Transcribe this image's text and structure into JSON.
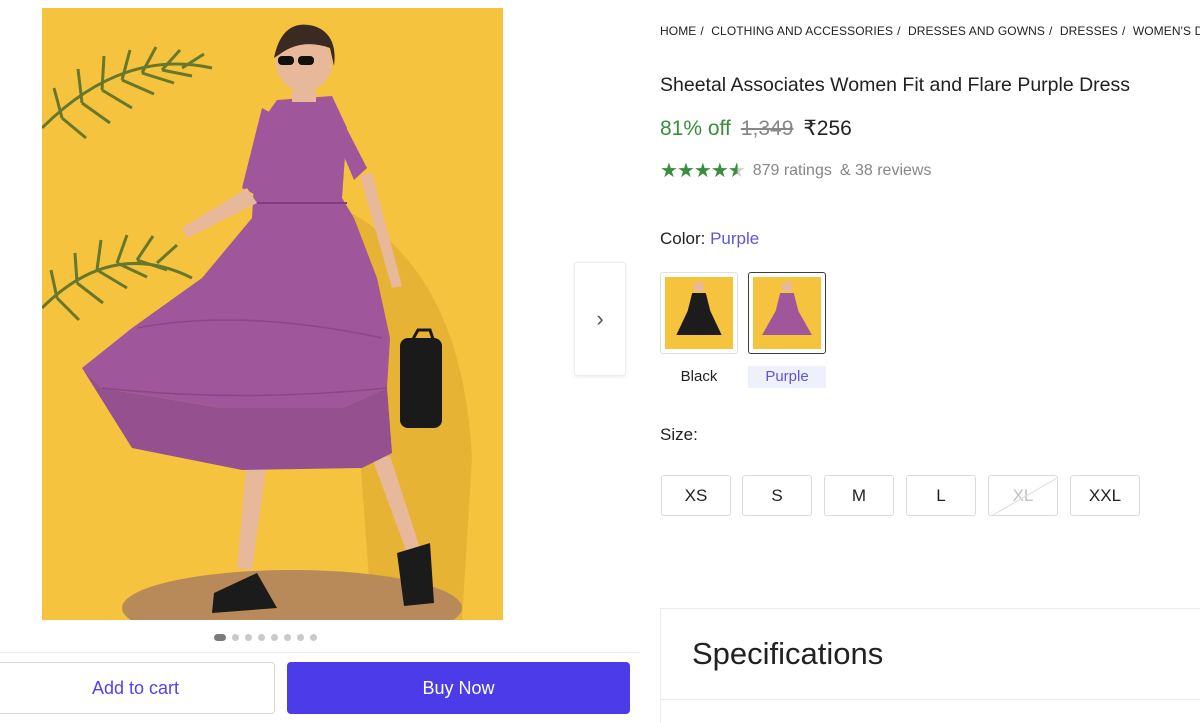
{
  "gallery": {
    "dots_count": 8,
    "active_dot": 0,
    "next_icon": "chevron-right-icon"
  },
  "actions": {
    "add_to_cart": "Add to cart",
    "buy_now": "Buy Now"
  },
  "breadcrumb": [
    "HOME",
    "CLOTHING AND ACCESSORIES",
    "DRESSES AND GOWNS",
    "DRESSES",
    "WOMEN'S D"
  ],
  "product": {
    "title": "Sheetal Associates Women Fit and Flare Purple Dress",
    "discount": "81% off",
    "mrp": "1,349",
    "price": "₹256",
    "rating_value": 4.5,
    "ratings": "879 ratings",
    "reviews": "& 38 reviews"
  },
  "color": {
    "label": "Color:",
    "selected": "Purple",
    "options": [
      {
        "name": "Black",
        "dress_color": "#1c1c1c"
      },
      {
        "name": "Purple",
        "dress_color": "#a0569a"
      }
    ]
  },
  "size": {
    "label": "Size:",
    "options": [
      {
        "label": "XS",
        "available": true
      },
      {
        "label": "S",
        "available": true
      },
      {
        "label": "M",
        "available": true
      },
      {
        "label": "L",
        "available": true
      },
      {
        "label": "XL",
        "available": false
      },
      {
        "label": "XXL",
        "available": true
      }
    ]
  },
  "specifications": {
    "title": "Specifications"
  },
  "colors": {
    "accent": "#4c3be8",
    "discount_green": "#388e3c",
    "backdrop_yellow": "#f6c33f",
    "dress_purple": "#a0569a"
  }
}
